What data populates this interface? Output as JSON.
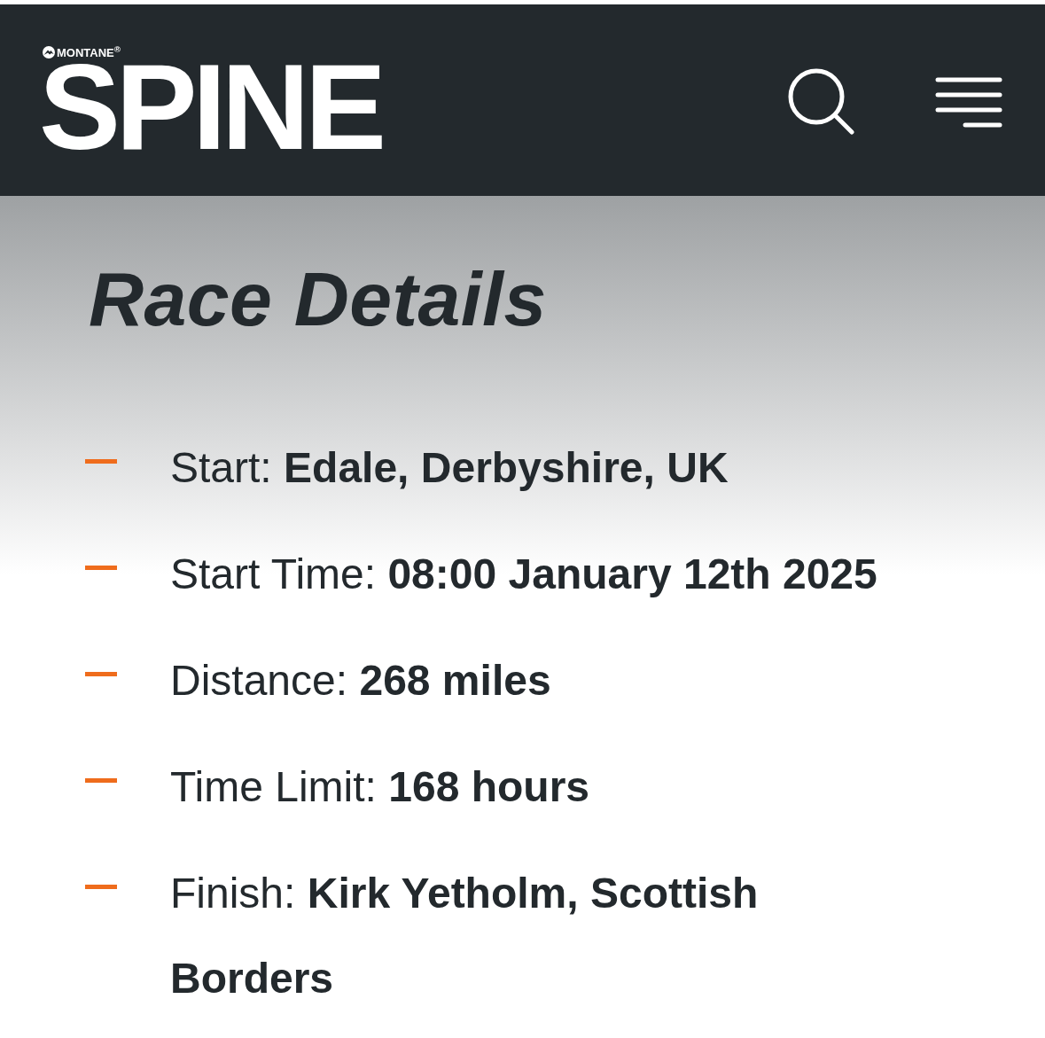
{
  "header": {
    "brand": "MONTANE$^{®}$",
    "logo": "SPINE"
  },
  "title": "Race Details",
  "details": [
    {
      "label": "Start:",
      "value": "Edale, Derbyshire, UK"
    },
    {
      "label": "Start Time:",
      "value": "08:00 January 12th 2025"
    },
    {
      "label": "Distance:",
      "value": "268 miles"
    },
    {
      "label": "Time Limit:",
      "value": "168 hours"
    },
    {
      "label": "Finish:",
      "value": "Kirk Yetholm, Scottish Borders"
    }
  ]
}
